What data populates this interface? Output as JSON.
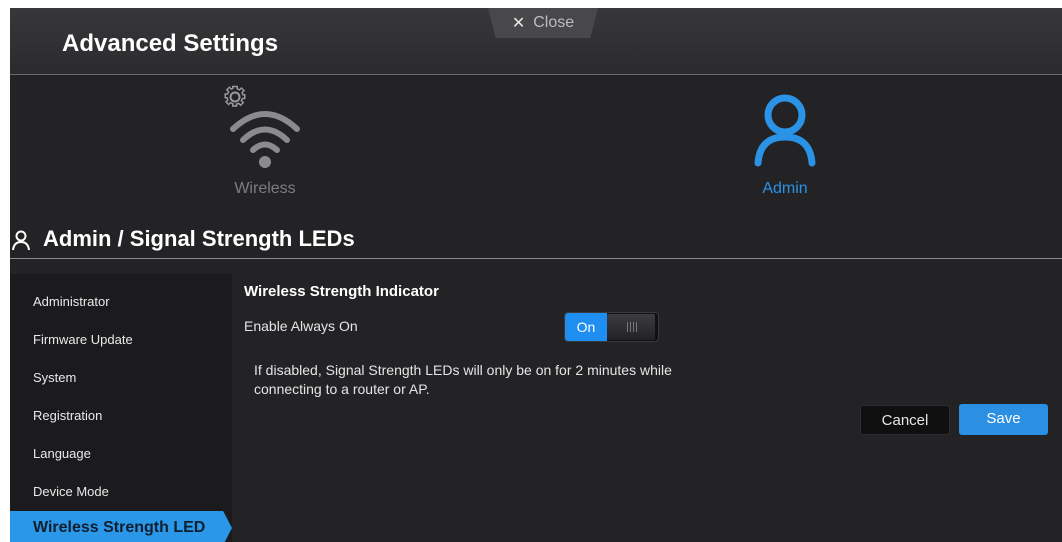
{
  "header": {
    "title": "Advanced Settings",
    "close_label": "Close"
  },
  "nav": [
    {
      "label": "Wireless",
      "icon": "wifi-gear-icon",
      "active": false
    },
    {
      "label": "Admin",
      "icon": "user-icon",
      "active": true
    }
  ],
  "page_heading": "Admin / Signal Strength LEDs",
  "sidebar": {
    "items": [
      {
        "label": "Administrator"
      },
      {
        "label": "Firmware Update"
      },
      {
        "label": "System"
      },
      {
        "label": "Registration"
      },
      {
        "label": "Language"
      },
      {
        "label": "Device Mode"
      },
      {
        "label": "Wireless Strength LED"
      }
    ]
  },
  "content": {
    "section_title": "Wireless Strength Indicator",
    "option_label": "Enable Always On",
    "toggle_state": "On",
    "note": "If disabled, Signal Strength LEDs will only be on for 2 minutes while connecting to a router or AP.",
    "cancel_label": "Cancel",
    "save_label": "Save"
  },
  "colors": {
    "accent": "#2b97e8",
    "background": "#232325",
    "inactive_nav": "#7d7d80"
  }
}
